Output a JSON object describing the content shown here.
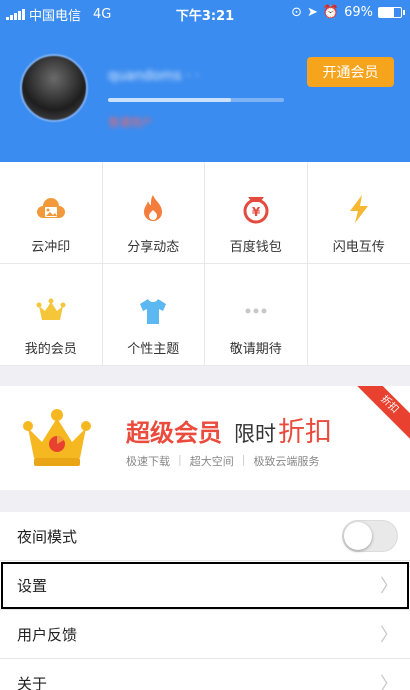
{
  "statusbar": {
    "carrier": "中国电信",
    "network": "4G",
    "time": "下午3:21",
    "battery": "69%",
    "battery_level": 0.69
  },
  "header": {
    "vip_button": "开通会员",
    "level_progress": 0.7
  },
  "grid": {
    "items": [
      {
        "label": "云冲印",
        "icon": "cloud-print-icon"
      },
      {
        "label": "分享动态",
        "icon": "flame-icon"
      },
      {
        "label": "百度钱包",
        "icon": "wallet-icon"
      },
      {
        "label": "闪电互传",
        "icon": "lightning-icon"
      },
      {
        "label": "我的会员",
        "icon": "crown-icon"
      },
      {
        "label": "个性主题",
        "icon": "tshirt-icon"
      },
      {
        "label": "敬请期待",
        "icon": "more-dots-icon"
      }
    ]
  },
  "banner": {
    "title_bold": "超级会员",
    "title_mid": "限时",
    "title_big": "折扣",
    "features": [
      "极速下载",
      "超大空间",
      "极致云端服务"
    ],
    "corner_tag": "折扣"
  },
  "settings": {
    "night_mode": "夜间模式",
    "settings": "设置",
    "feedback": "用户反馈",
    "about": "关于"
  },
  "colors": {
    "primary": "#3b8cf0",
    "accent": "#f7a41d",
    "red": "#ea4b3c"
  }
}
